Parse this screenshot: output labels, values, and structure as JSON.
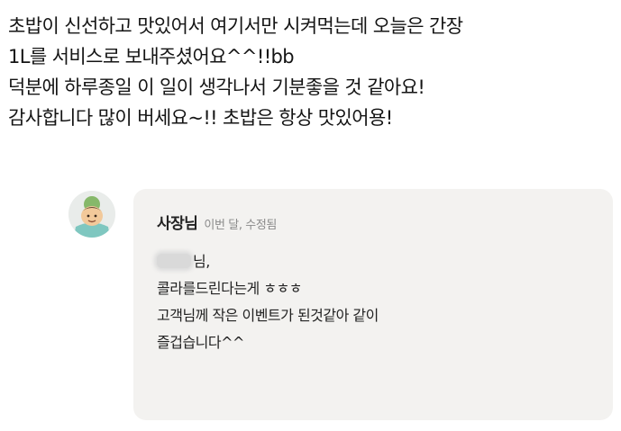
{
  "review": {
    "lines": [
      "초밥이 신선하고 맛있어서 여기서만 시켜먹는데 오늘은 간장",
      "1L를 서비스로 보내주셨어요^^!!bb",
      "덕분에 하루종일 이 일이 생각나서 기분좋을 것 같아요!",
      "감사합니다 많이 버세요~!! 초밥은 항상 맛있어용!"
    ]
  },
  "reply": {
    "author": "사장님",
    "meta": "이번 달, 수정됨",
    "avatar_icon": "owner-avatar-icon",
    "greeting_suffix": "님,",
    "lines": [
      "콜라를드린다는게 ㅎㅎㅎ",
      "고객님께 작은 이벤트가 된것같아 같이",
      "즐겁습니다^^"
    ]
  },
  "colors": {
    "bubble_background": "#f3f2f0",
    "meta_text": "#8a8a8a"
  }
}
